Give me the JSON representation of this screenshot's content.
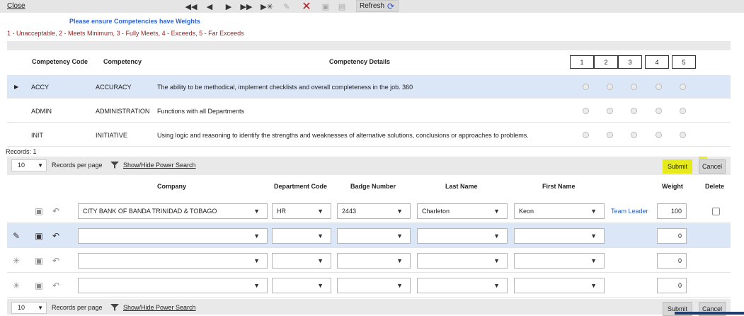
{
  "toolbar": {
    "close_label": "Close",
    "refresh_label": "Refresh",
    "buttons": [
      "first-icon",
      "prev-icon",
      "next-icon",
      "last-icon",
      "add-new-icon",
      "edit-icon",
      "delete-icon",
      "save-icon",
      "save-edit-icon"
    ]
  },
  "notice": "Please ensure Competencies have Weights",
  "legend": "1 - Unacceptable, 2 - Meets Minimum, 3 - Fully Meets, 4 - Exceeds, 5 - Far Exceeds",
  "competency_table": {
    "headers": {
      "code": "Competency Code",
      "name": "Competency",
      "details": "Competency Details"
    },
    "ratings": [
      "1",
      "2",
      "3",
      "4",
      "5"
    ],
    "rows": [
      {
        "code": "ACCY",
        "name": "ACCURACY",
        "details": "The ability to be methodical, implement checklists and overall completeness in the job. 360",
        "selected": true
      },
      {
        "code": "ADMIN",
        "name": "ADMINISTRATION",
        "details": "Functions with all Departments",
        "selected": false
      },
      {
        "code": "INIT",
        "name": "INITIATIVE",
        "details": "Using logic and reasoning to identify the strengths and weaknesses of alternative solutions, conclusions or approaches to problems.",
        "selected": false
      }
    ]
  },
  "records_label": "Records:  1",
  "pager": {
    "per_page_value": "10",
    "per_page_label": "Records per page",
    "power_search_label": "Show/Hide Power Search",
    "submit_label": "Submit",
    "cancel_label": "Cancel"
  },
  "evaluator_grid": {
    "headers": {
      "company": "Company",
      "department": "Department Code",
      "badge": "Badge Number",
      "last_name": "Last Name",
      "first_name": "First Name",
      "weight": "Weight",
      "delete": "Delete"
    },
    "rows": [
      {
        "company": "CITY BANK OF BANDA TRINIDAD & TOBAGO",
        "department": "HR",
        "badge": "2443",
        "last_name": "Charleton",
        "first_name": "Keon",
        "role": "Team Leader",
        "weight": "100",
        "state": "existing"
      },
      {
        "company": "",
        "department": "",
        "badge": "",
        "last_name": "",
        "first_name": "",
        "role": "",
        "weight": "0",
        "state": "editing"
      },
      {
        "company": "",
        "department": "",
        "badge": "",
        "last_name": "",
        "first_name": "",
        "role": "",
        "weight": "0",
        "state": "new"
      },
      {
        "company": "",
        "department": "",
        "badge": "",
        "last_name": "",
        "first_name": "",
        "role": "",
        "weight": "0",
        "state": "new"
      }
    ]
  },
  "colors": {
    "accent_blue": "#2e63d6",
    "legend_red": "#9b1b1b",
    "selected_row": "#dbe6f6",
    "highlight_yellow": "#e6ea1c"
  }
}
